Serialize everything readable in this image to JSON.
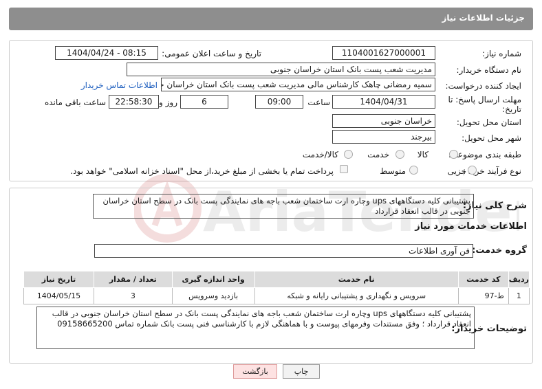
{
  "header": {
    "title": "جزئیات اطلاعات نیاز"
  },
  "form": {
    "need_number_label": "شماره نیاز:",
    "need_number": "1104001627000001",
    "announce_label": "تاریخ و ساعت اعلان عمومی:",
    "announce_value": "1404/04/24 - 08:15",
    "buyer_org_label": "نام دستگاه خریدار:",
    "buyer_org": "مدیریت شعب پست بانک استان خراسان جنوبی",
    "creator_label": "ایجاد کننده درخواست:",
    "creator": "سمیه رمضانی چاهک کارشناس مالی مدیریت شعب پست بانک استان خراسان جنوبی",
    "contact_link": "اطلاعات تماس خریدار",
    "deadline_label": "مهلت ارسال پاسخ: تا تاریخ:",
    "deadline_date": "1404/04/31",
    "time_label": "ساعت",
    "deadline_time": "09:00",
    "days_value": "6",
    "days_label": "روز و",
    "remaining_time": "22:58:30",
    "remaining_label": "ساعت باقی مانده",
    "province_label": "استان محل تحویل:",
    "province": "خراسان جنوبی",
    "city_label": "شهر محل تحویل:",
    "city": "بیرجند",
    "category_label": "طبقه بندی موضوعی:",
    "category_options": [
      "کالا",
      "خدمت",
      "کالا/خدمت"
    ],
    "process_label": "نوع فرآیند خرید :",
    "process_options": [
      "جزیی",
      "متوسط"
    ],
    "payment_note": "پرداخت تمام یا بخشی از مبلغ خرید،از محل \"اسناد خزانه اسلامی\" خواهد بود."
  },
  "summary": {
    "label": "شرح کلی نیاز:",
    "text": "پشتیبانی کلیه دستگاههای ups  وچاره ارت ساختمان شعب باجه های نمایندگی پست بانک در سطح استان خراسان جنوبی در قالب انعقاد قرارداد"
  },
  "services": {
    "title": "اطلاعات خدمات مورد نیاز",
    "group_label": "گروه خدمت:",
    "group_value": "فن آوری اطلاعات",
    "columns": [
      "ردیف",
      "کد خدمت",
      "نام خدمت",
      "واحد اندازه گیری",
      "تعداد / مقدار",
      "تاریخ نیاز"
    ],
    "rows": [
      [
        "1",
        "ط-97",
        "سرویس و نگهداری و پشتیبانی رایانه و شبکه",
        "بازدید وسرویس",
        "3",
        "1404/05/15"
      ]
    ]
  },
  "buyer_notes": {
    "label": "توضیحات خریدار:",
    "text": "پشتیبانی کلیه دستگاههای ups  وچاره ارت ساختمان شعب باجه های نمایندگی پست بانک در سطح استان خراسان جنوبی در قالب انعقاد قرارداد ؛ وفق مستندات  وفرمهای پیوست و با هماهنگی لازم با کارشناسی فنی پست بانک شماره تماس 09158665200"
  },
  "buttons": {
    "print": "چاپ",
    "back": "بازگشت"
  },
  "watermark": "AriaTender.neT"
}
